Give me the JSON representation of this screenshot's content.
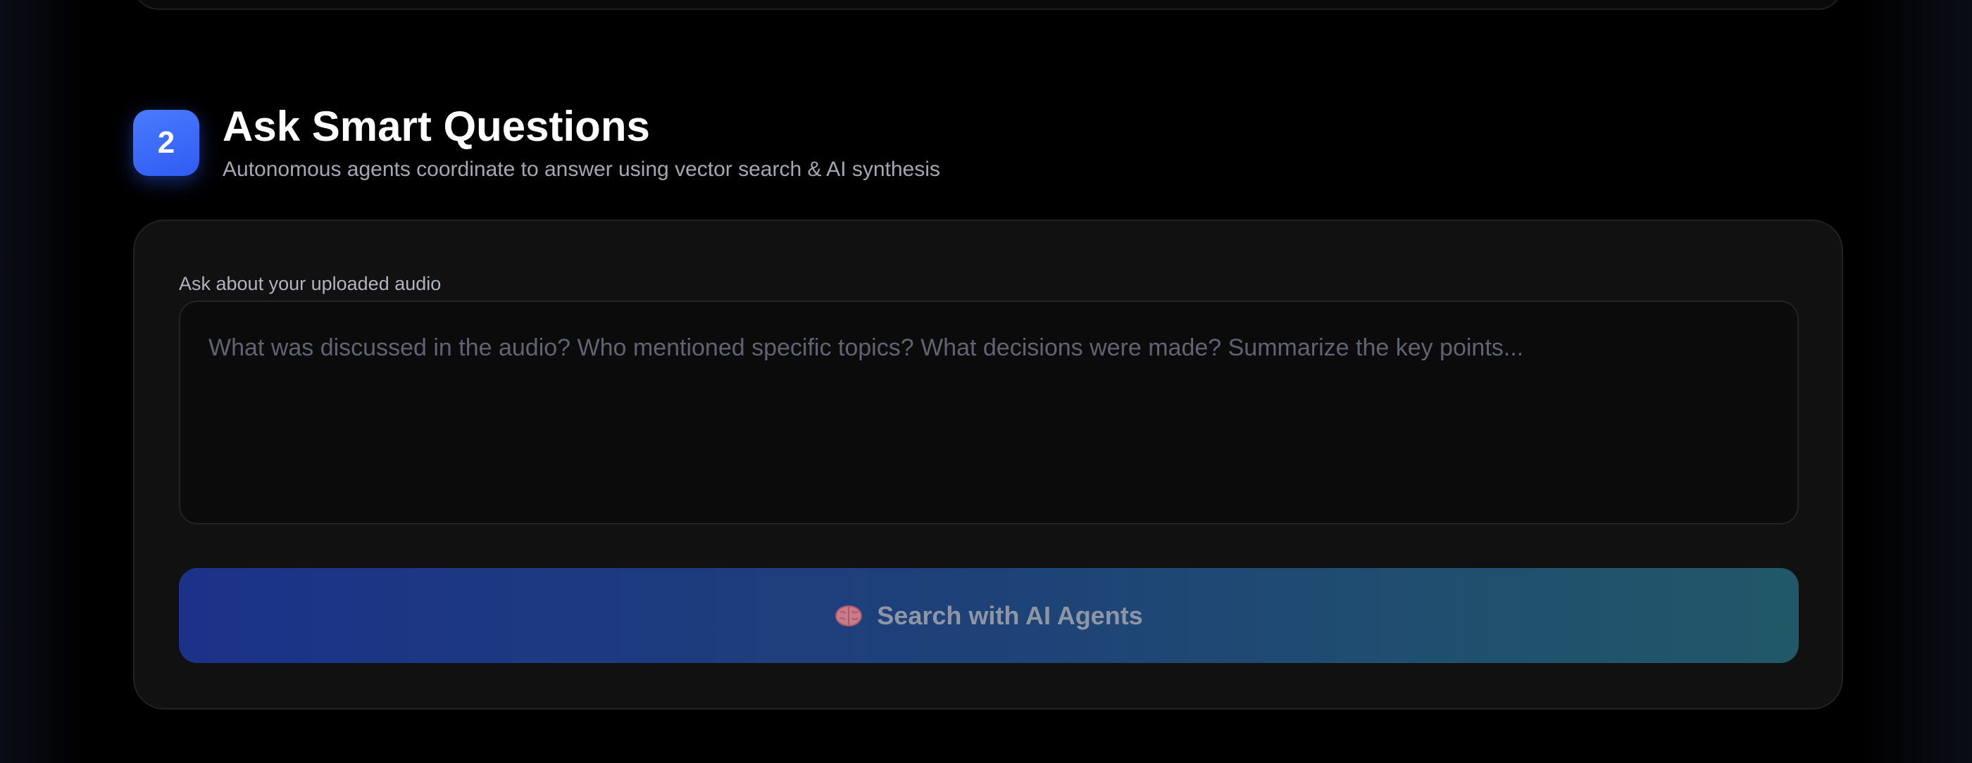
{
  "step": {
    "number": "2",
    "title": "Ask Smart Questions",
    "subtitle": "Autonomous agents coordinate to answer using vector search & AI synthesis"
  },
  "query": {
    "label": "Ask about your uploaded audio",
    "placeholder": "What was discussed in the audio? Who mentioned specific topics? What decisions were made? Summarize the key points...",
    "value": ""
  },
  "search_button": {
    "label": "Search with AI Agents",
    "icon": "brain-icon"
  },
  "colors": {
    "background": "#000000",
    "card": "#111111",
    "accent_blue": "#3b6cf6",
    "button_gradient_start": "#1c3289",
    "button_gradient_end": "#215868"
  }
}
